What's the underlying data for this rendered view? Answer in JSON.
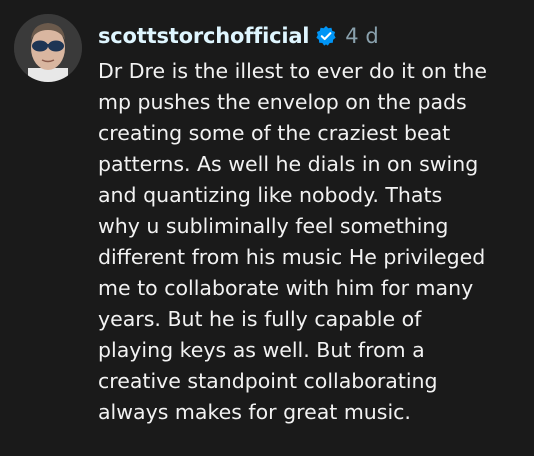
{
  "comment": {
    "username": "scottstorchofficial",
    "time": "4 d",
    "lines": [
      "Dr Dre is the illest to ever do it on the",
      "mp pushes the envelop on the pads",
      "creating some of the craziest beat",
      "patterns. As well he dials in on swing",
      "and quantizing like nobody. Thats",
      "why u subliminally feel something",
      "different from his music He privileged",
      "me to collaborate with him for many",
      "years. But he is fully capable of",
      "playing keys as well. But from a",
      "creative standpoint collaborating",
      "always makes for great music."
    ]
  },
  "colors": {
    "background": "#1a1a1a",
    "username": "#dff6ff",
    "verified_badge": "#0095f6",
    "time": "#8aa1ad",
    "text": "#f2f2f2"
  },
  "icons": {
    "avatar": "profile-avatar",
    "verified": "verified-badge-icon"
  }
}
